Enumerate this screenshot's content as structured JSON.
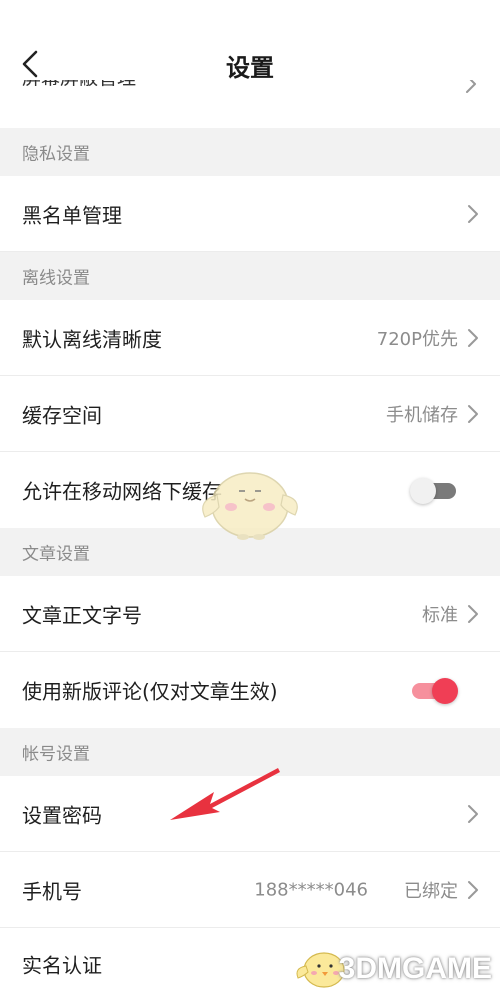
{
  "header": {
    "title": "设置",
    "partial_row_label": "屏幕屏蔽管理"
  },
  "sections": {
    "privacy": "隐私设置",
    "offline": "离线设置",
    "article": "文章设置",
    "account": "帐号设置"
  },
  "rows": {
    "blacklist": {
      "label": "黑名单管理"
    },
    "offline_quality": {
      "label": "默认离线清晰度",
      "value": "720P优先"
    },
    "cache_space": {
      "label": "缓存空间",
      "value": "手机储存"
    },
    "mobile_cache": {
      "label": "允许在移动网络下缓存",
      "enabled": false
    },
    "font_size": {
      "label": "文章正文字号",
      "value": "标准"
    },
    "new_comments": {
      "label": "使用新版评论(仅对文章生效)",
      "enabled": true
    },
    "set_password": {
      "label": "设置密码"
    },
    "phone": {
      "label": "手机号",
      "number": "188*****046",
      "status": "已绑定"
    },
    "real_name": {
      "label": "实名认证"
    }
  },
  "watermark": {
    "text": "3DMGAME"
  },
  "colors": {
    "accent": "#f03e55",
    "section_bg": "#f2f2f2",
    "arrow": "#e8323f"
  }
}
